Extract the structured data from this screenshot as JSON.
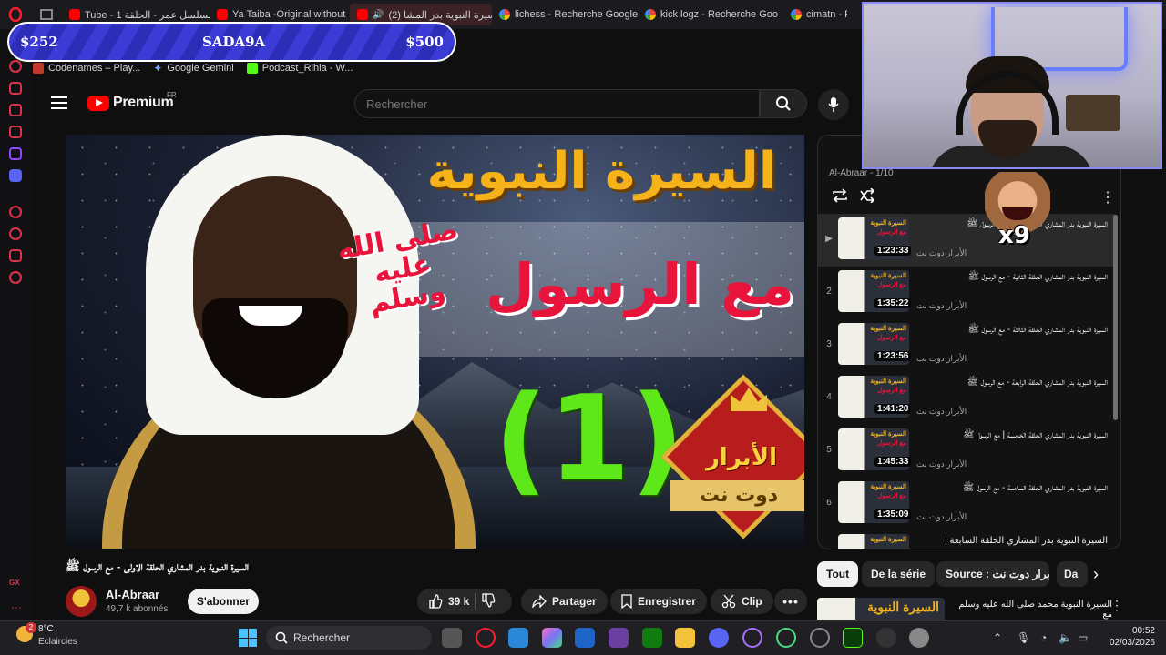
{
  "browser": {
    "tabs": [
      {
        "label": "Tube - مسلسل عمر - الحلقة 1",
        "icon": "youtube-icon"
      },
      {
        "label": "Ya Taiba -Original without",
        "icon": "youtube-icon"
      },
      {
        "label": "(2) السيرة النبوية بدر المشا",
        "icon": "youtube-icon",
        "active": true
      },
      {
        "label": "lichess - Recherche Google",
        "icon": "google-icon"
      },
      {
        "label": "kick logz - Recherche Goo",
        "icon": "google-icon"
      },
      {
        "label": "cimatn - Re",
        "icon": "google-icon"
      }
    ],
    "bookmarks": [
      "Codenames – Play...",
      "Google Gemini",
      "Podcast_Rihla - W..."
    ]
  },
  "donation": {
    "left": "$252",
    "name": "SADA9A",
    "right": "$500"
  },
  "youtube": {
    "logo": "Premium",
    "region": "FR",
    "search_placeholder": "Rechercher"
  },
  "video": {
    "thumb_title": "السيرة النبوية",
    "thumb_subtitle": "مع الرسول",
    "thumb_salla": "صلى الله عليه وسلم",
    "thumb_number": "(1)",
    "badge_text": "الأبرار",
    "badge_ribbon": "دوت نت",
    "title": "السيرة النبوية بدر المشاري الحلقة الاولى - مع الرسول ﷺ",
    "channel": "Al-Abraar",
    "subscribers": "49,7 k abonnés",
    "subscribe": "S'abonner",
    "likes": "39 k",
    "share": "Partager",
    "save": "Enregistrer",
    "clip": "Clip"
  },
  "playlist": {
    "header": "Al-Abraar - 1/10",
    "channel": "الأبرار دوت نت",
    "items": [
      {
        "index": "▶",
        "duration": "1:23:33",
        "title": "السيرة النبوية بدر المشاري الحلقة الاولى - مع الرسول ﷺ"
      },
      {
        "index": "2",
        "duration": "1:35:22",
        "title": "السيرة النبوية بدر المشاري الحلقة الثانية - مع الرسول ﷺ"
      },
      {
        "index": "3",
        "duration": "1:23:56",
        "title": "السيرة النبوية بدر المشاري الحلقة الثالثة - مع الرسول ﷺ"
      },
      {
        "index": "4",
        "duration": "1:41:20",
        "title": "السيرة النبوية بدر المشاري الحلقة الرابعة - مع الرسول ﷺ"
      },
      {
        "index": "5",
        "duration": "1:45:33",
        "title": "السيرة النبوية بدر المشاري الحلقة الخامسة | مع الرسول ﷺ"
      },
      {
        "index": "6",
        "duration": "1:35:09",
        "title": "السيرة النبوية بدر المشاري الحلقة السادسة - مع الرسول ﷺ"
      },
      {
        "index": "",
        "duration": "",
        "title": "السيرة النبوية بدر المشاري الحلقة السابعة |"
      }
    ]
  },
  "chips": [
    "Tout",
    "De la série",
    "Source : الأبرار دوت نت",
    "Da"
  ],
  "recommendation": {
    "thumb": "السيرة النبوية",
    "title": "السيرة النبوية محمد صلى الله عليه وسلم مع"
  },
  "emote": {
    "multiplier": "x9"
  },
  "taskbar": {
    "temp": "8°C",
    "weather": "Eclaircies",
    "search": "Rechercher",
    "time": "00:52",
    "date": "02/03/2026",
    "notif_count": "2"
  },
  "colors": {
    "accent_red": "#ff0000",
    "donation_blue": "#3b3bd6",
    "cam_border": "#8b8bf5"
  }
}
